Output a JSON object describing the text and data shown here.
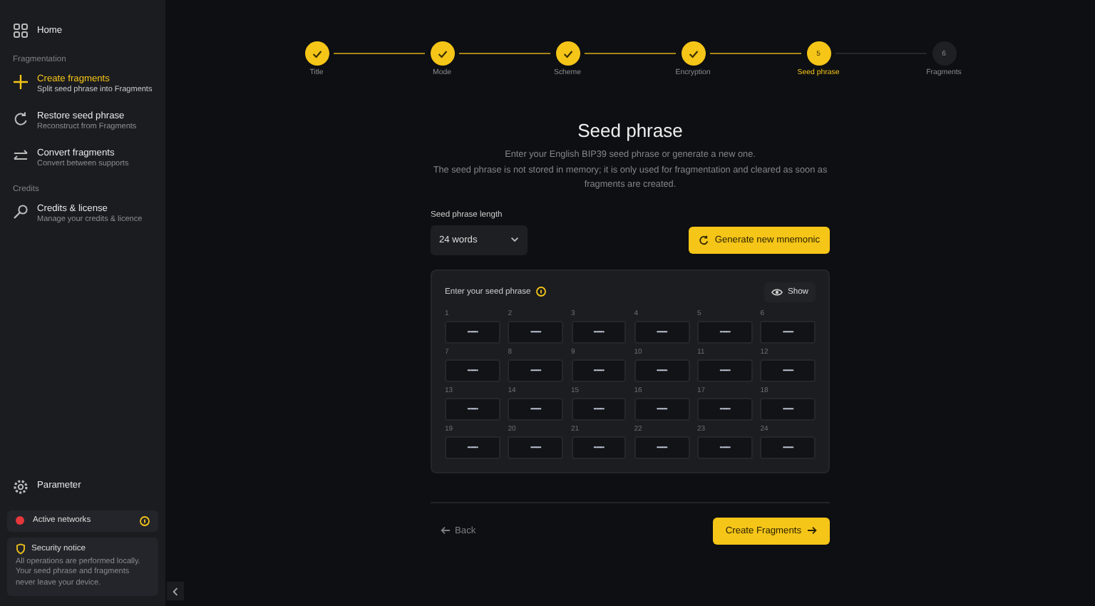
{
  "sidebar": {
    "home": {
      "label": "Home",
      "selected": false
    },
    "sections": [
      {
        "title": "Fragmentation",
        "items": [
          {
            "kind": "plus",
            "label": "Create fragments",
            "subtitle": "Split seed phrase into Fragments",
            "selected": true
          },
          {
            "kind": "restore",
            "label": "Restore seed phrase",
            "subtitle": "Reconstruct from Fragments",
            "selected": false
          },
          {
            "kind": "convert",
            "label": "Convert fragments",
            "subtitle": "Convert between supports",
            "selected": false
          }
        ]
      },
      {
        "title": "Credits",
        "items": [
          {
            "kind": "key",
            "label": "Credits & license",
            "subtitle": "Manage your credits & licence",
            "selected": false
          }
        ]
      }
    ],
    "parameter": "Parameter",
    "networks": {
      "label": "Active networks",
      "color": "#e5383b"
    },
    "notice": {
      "title": "Security notice",
      "text": "All operations are performed locally. Your seed phrase and fragments never leave your device."
    }
  },
  "steps": [
    {
      "label": "Title",
      "completed": true,
      "selected": false
    },
    {
      "label": "Mode",
      "completed": true,
      "selected": false
    },
    {
      "label": "Scheme",
      "completed": true,
      "selected": false
    },
    {
      "label": "Encryption",
      "completed": true,
      "selected": false
    },
    {
      "label": "Seed phrase",
      "completed": false,
      "selected": true,
      "number": "5"
    },
    {
      "label": "Fragments",
      "completed": false,
      "selected": false,
      "number": "6"
    }
  ],
  "page": {
    "title": "Seed phrase",
    "description": "Enter your English BIP39 seed phrase or generate a new one.",
    "note": "The seed phrase is not stored in memory; it is only used for fragmentation and cleared as soon as fragments are created."
  },
  "length": {
    "label": "Seed phrase length",
    "value": "24 words"
  },
  "generate_button": "Generate new mnemonic",
  "entry": {
    "title": "Enter your seed phrase",
    "show_button": "Show",
    "words": [
      {
        "index": "1",
        "value": "••••••••"
      },
      {
        "index": "2",
        "value": "••••••••"
      },
      {
        "index": "3",
        "value": "••••••••"
      },
      {
        "index": "4",
        "value": "••••••••"
      },
      {
        "index": "5",
        "value": "••••••••"
      },
      {
        "index": "6",
        "value": "••••••••"
      },
      {
        "index": "7",
        "value": "••••••••"
      },
      {
        "index": "8",
        "value": "••••••••"
      },
      {
        "index": "9",
        "value": "••••••••"
      },
      {
        "index": "10",
        "value": "••••••••"
      },
      {
        "index": "11",
        "value": "••••••••"
      },
      {
        "index": "12",
        "value": "••••••••"
      },
      {
        "index": "13",
        "value": "••••••••"
      },
      {
        "index": "14",
        "value": "••••••••"
      },
      {
        "index": "15",
        "value": "••••••••"
      },
      {
        "index": "16",
        "value": "••••••••"
      },
      {
        "index": "17",
        "value": "••••••••"
      },
      {
        "index": "18",
        "value": "••••••••"
      },
      {
        "index": "19",
        "value": "••••••••"
      },
      {
        "index": "20",
        "value": "••••••••"
      },
      {
        "index": "21",
        "value": "••••••••"
      },
      {
        "index": "22",
        "value": "••••••••"
      },
      {
        "index": "23",
        "value": "••••••••"
      },
      {
        "index": "24",
        "value": "••••••••"
      }
    ]
  },
  "back_button": "Back",
  "create_button": "Create Fragments"
}
